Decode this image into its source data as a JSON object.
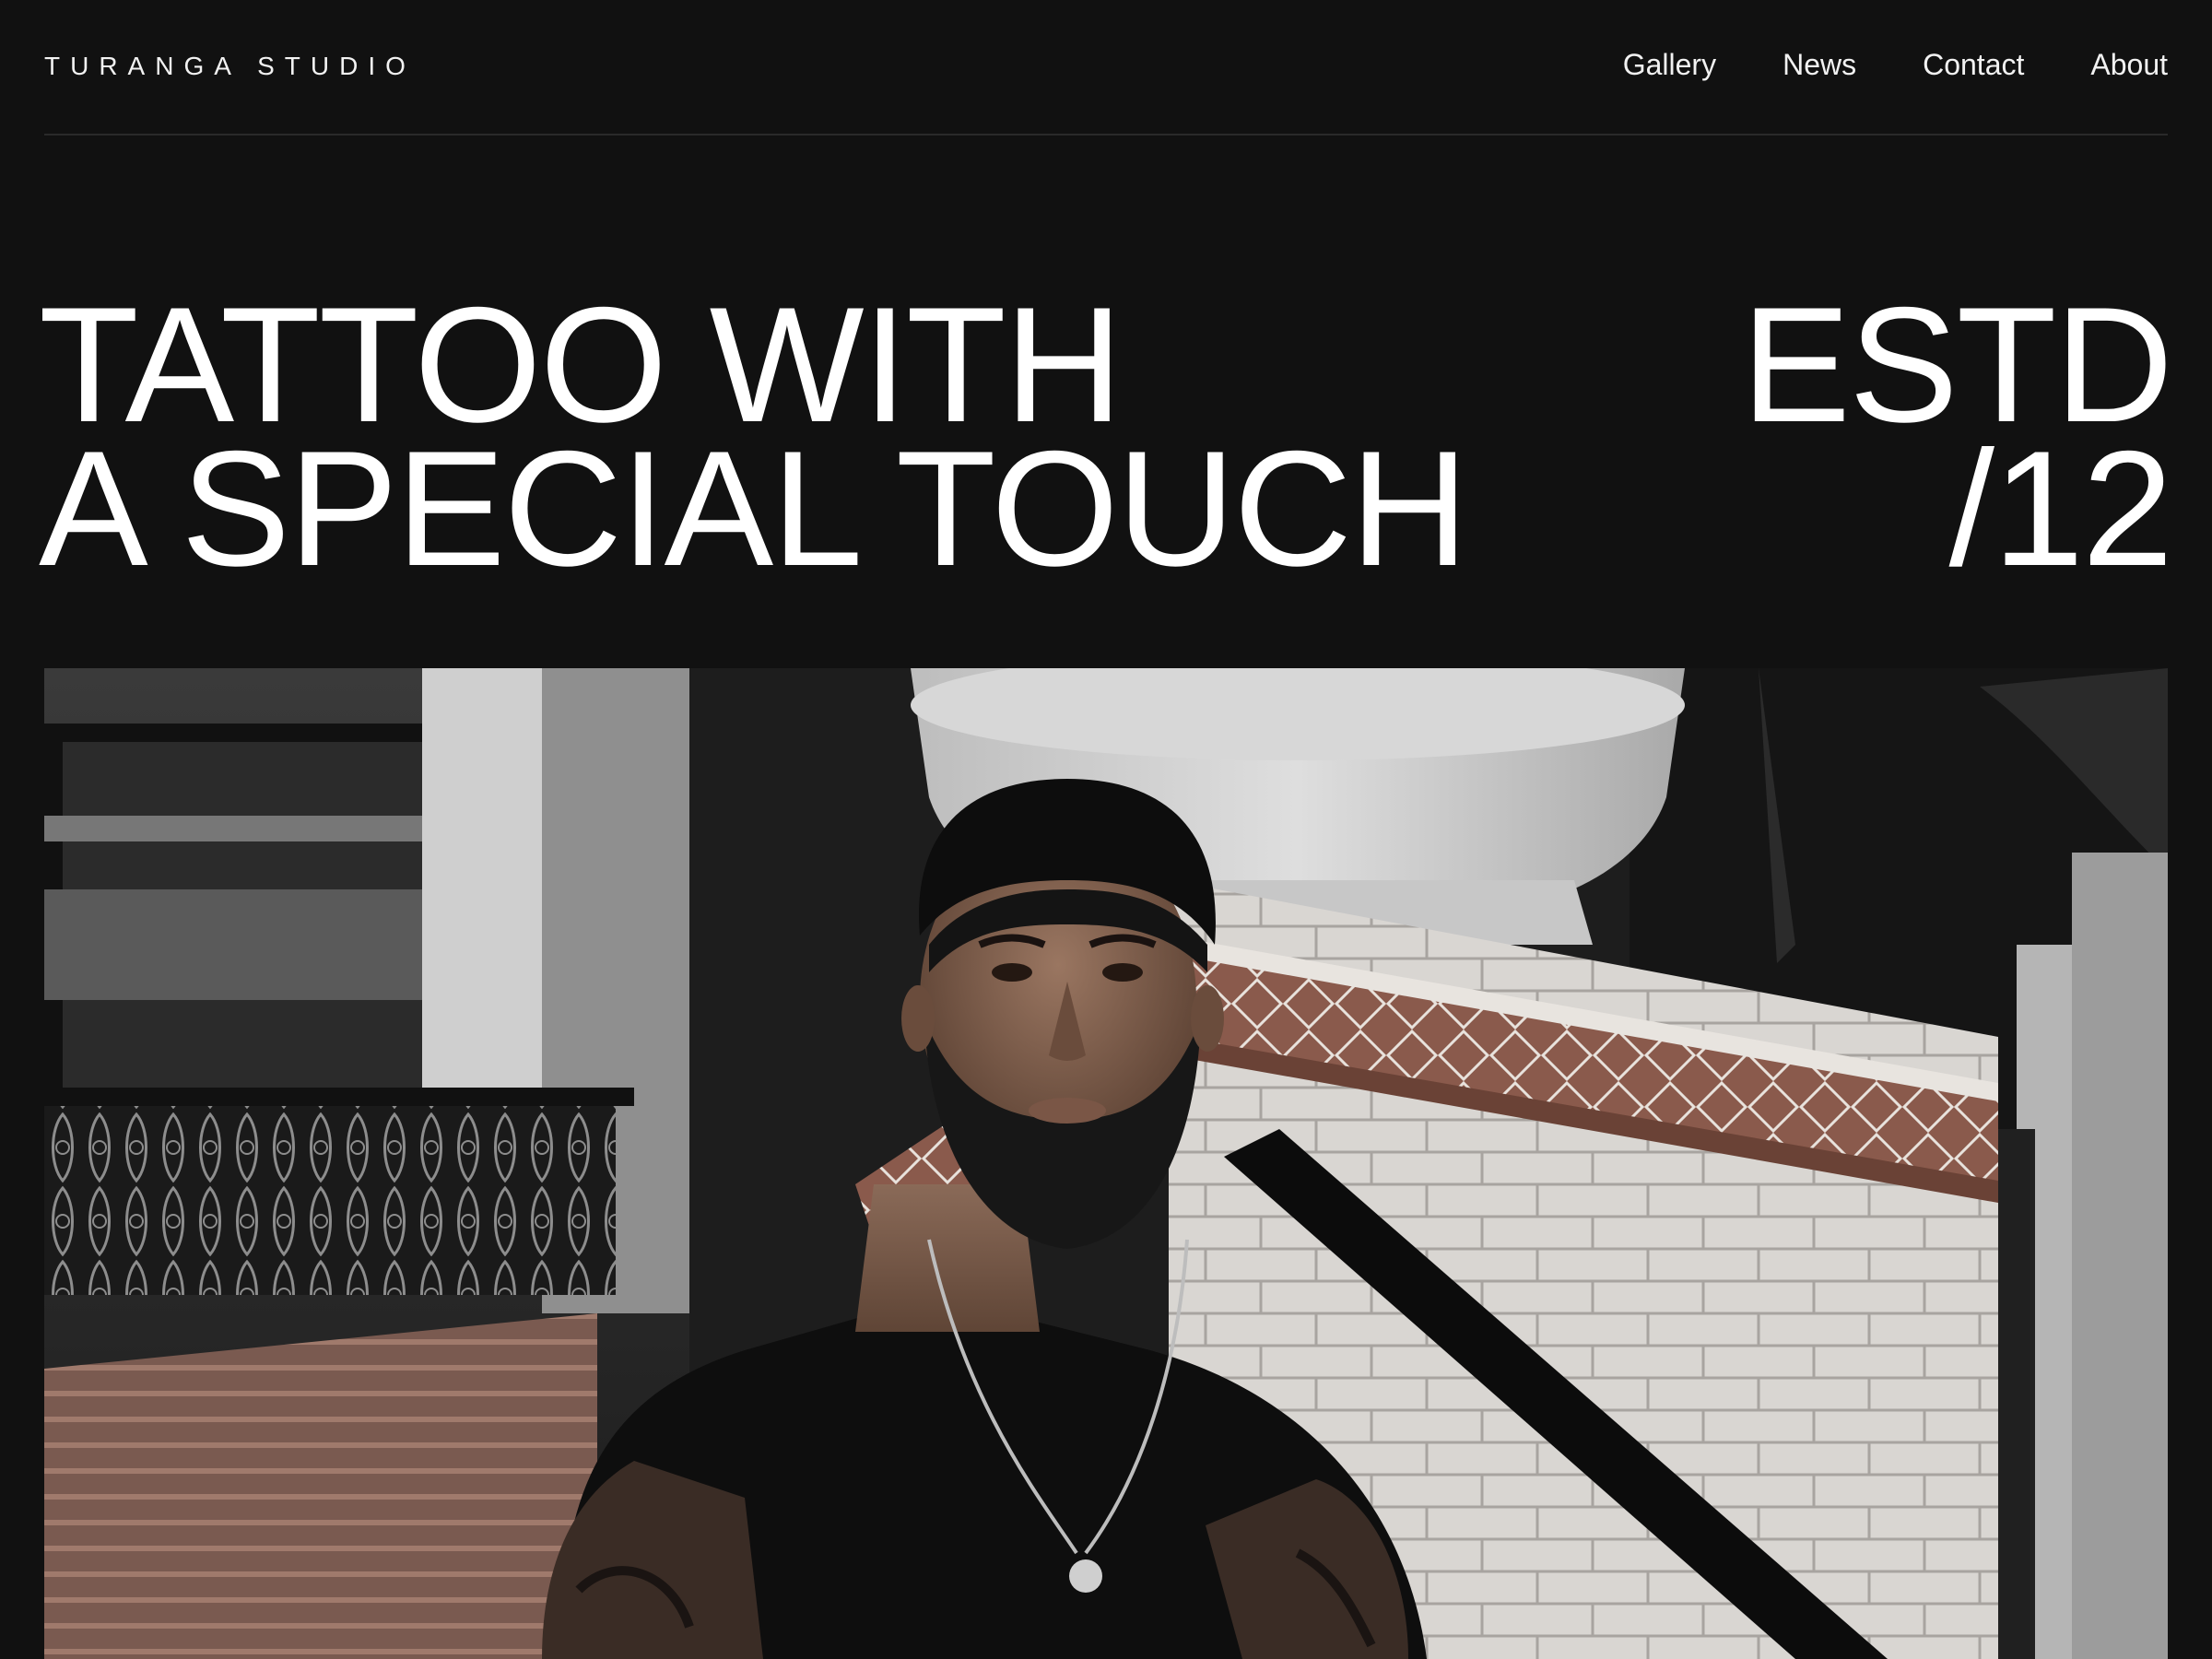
{
  "header": {
    "logo": "TURANGA STUDIO",
    "nav": [
      {
        "label": "Gallery"
      },
      {
        "label": "News"
      },
      {
        "label": "Contact"
      },
      {
        "label": "About"
      }
    ]
  },
  "hero": {
    "title_line1": "TATTOO WITH",
    "title_line2": "A SPECIAL TOUCH",
    "estd_line1": "ESTD",
    "estd_line2": "/12"
  },
  "colors": {
    "background": "#111111",
    "text": "#ffffff",
    "divider": "#2a2a2a"
  }
}
